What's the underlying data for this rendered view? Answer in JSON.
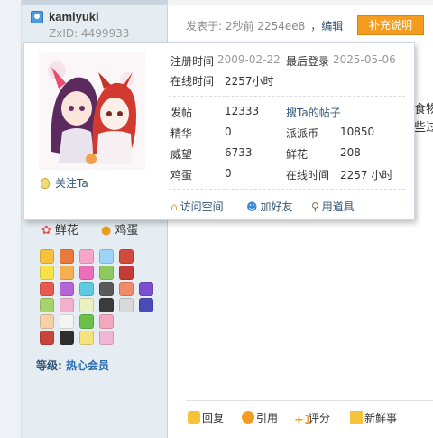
{
  "user": {
    "name": "kamiyuki",
    "zxid": "ZxID: 4499933"
  },
  "post": {
    "meta": "发表于: 2秒前 2254ee8",
    "edit_label": "，编辑",
    "supplement_label": "补充说明",
    "text_line1": "食物",
    "text_line2": "些过"
  },
  "popup": {
    "register_label": "注册时间",
    "register_value": "2009-02-22",
    "last_login_label": "最后登录",
    "last_login_value": "2025-05-06",
    "online_label": "在线时间",
    "online_value": "2257小时",
    "follow_label": "关注Ta",
    "stats": {
      "posts_label": "发帖",
      "posts_value": "12333",
      "search_posts_label": "搜Ta的帖子",
      "essence_label": "精华",
      "essence_value": "0",
      "coins_label": "派派币",
      "coins_value": "10850",
      "prestige_label": "威望",
      "prestige_value": "6733",
      "flowers_label": "鲜花",
      "flowers_value": "208",
      "eggs_label": "鸡蛋",
      "eggs_value": "0",
      "online2_label": "在线时间",
      "online2_value": "2257 小时"
    },
    "links": {
      "visit_label": "访问空间",
      "add_friend_label": "加好友",
      "use_item_label": "用道具"
    }
  },
  "sidebar": {
    "flower_btn": "鲜花",
    "egg_btn": "鸡蛋",
    "level_label": "等级: ",
    "level_value": "热心会员"
  },
  "actions": {
    "reply": "回复",
    "quote": "引用",
    "rate": "评分",
    "news": "新鲜事"
  },
  "colors": {
    "accent_orange": "#f39c1f",
    "link_blue": "#335577",
    "sidebar_bg": "#e5edf2"
  }
}
